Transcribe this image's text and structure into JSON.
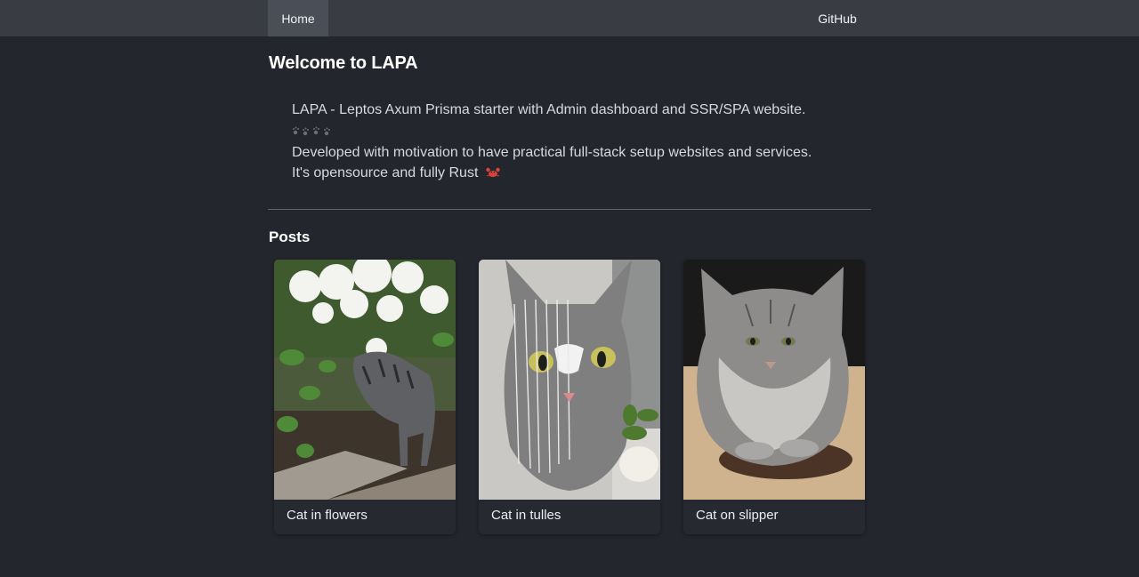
{
  "nav": {
    "home_label": "Home",
    "github_label": "GitHub"
  },
  "hero": {
    "title": "Welcome to LAPA",
    "line1": "LAPA - Leptos Axum Prisma starter with Admin dashboard and SSR/SPA website.",
    "paws_icon": "paw-prints-icon",
    "line2": "Developed with motivation to have practical full-stack setup websites and services.",
    "line3": "It's opensource and fully Rust",
    "crab_icon": "crab-emoji-icon"
  },
  "posts": {
    "title": "Posts",
    "items": [
      {
        "caption": "Cat in flowers",
        "image": "photo of a grey tabby cat under white hydrangea flowers"
      },
      {
        "caption": "Cat in tulles",
        "image": "photo of a grey tabby cat with white tulle veil on head"
      },
      {
        "caption": "Cat on slipper",
        "image": "photo of a fluffy grey cat lying on a slipper"
      }
    ]
  },
  "colors": {
    "background": "#23262c",
    "topbar": "#393c43",
    "active_tab": "#4a4e56",
    "text": "#e6e7ea",
    "crab": "#d9443a"
  }
}
